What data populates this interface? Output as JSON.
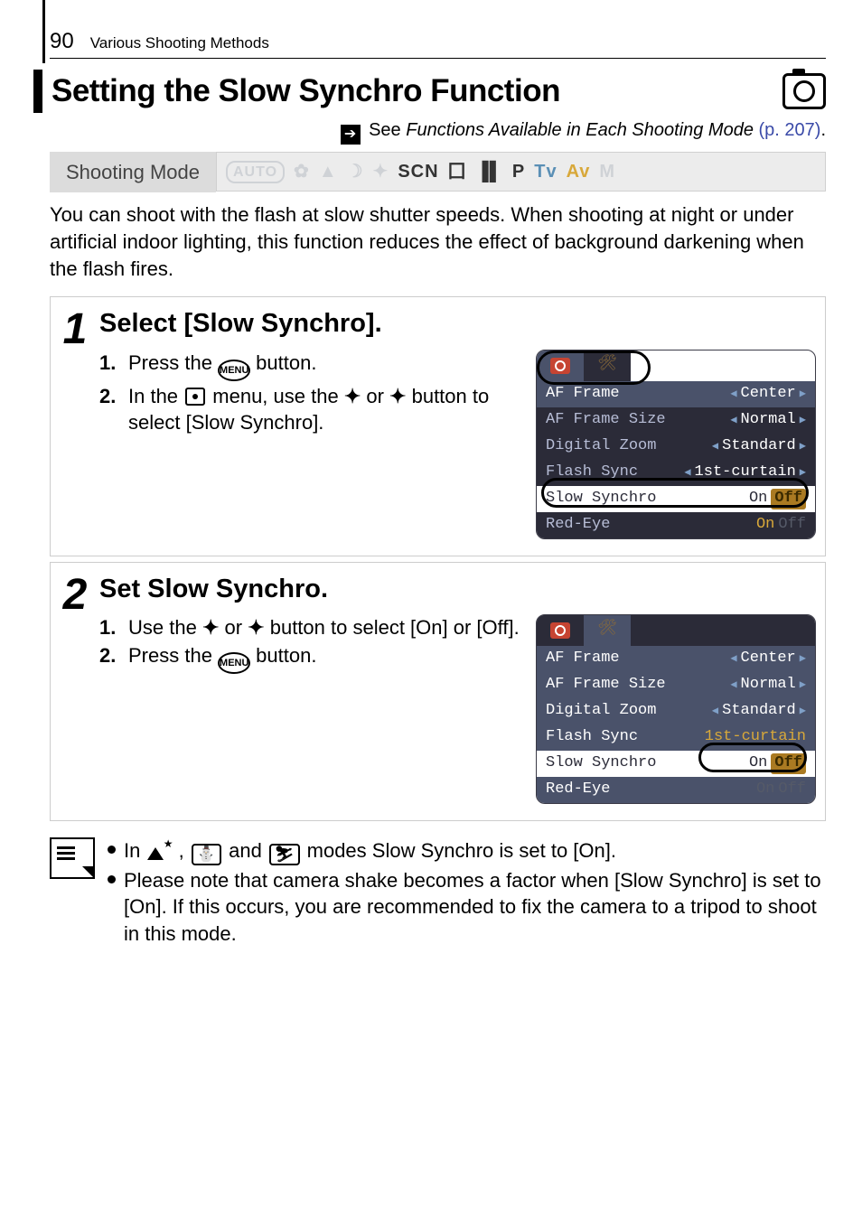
{
  "page": {
    "number": "90",
    "section": "Various Shooting Methods"
  },
  "heading": "Setting the Slow Synchro Function",
  "see": {
    "prefix": "See ",
    "italic": "Functions Available in Each Shooting Mode",
    "link": "(p. 207)",
    "dot": "."
  },
  "mode": {
    "label": "Shooting Mode",
    "band": {
      "auto": "AUTO",
      "scn": "SCN",
      "p": "P",
      "tv": "Tv",
      "av": "Av",
      "m": "M"
    }
  },
  "intro": "You can shoot with the flash at slow shutter speeds. When shooting at night or under artificial indoor lighting, this function reduces the effect of background darkening when the flash fires.",
  "steps": [
    {
      "num": "1",
      "title": "Select [Slow Synchro].",
      "lines": [
        {
          "lbl": "1.",
          "before": "Press the ",
          "btn": "MENU",
          "after": " button."
        },
        {
          "lbl": "2.",
          "text_a": "In the ",
          "text_b": " menu, use the ",
          "text_c": " or ",
          "text_d": " button to select [Slow Synchro]."
        }
      ],
      "shot": {
        "rows": [
          {
            "k": "AF Frame",
            "v": "Center",
            "hl": true
          },
          {
            "k": "AF Frame Size",
            "v": "Normal"
          },
          {
            "k": "Digital Zoom",
            "v": "Standard"
          },
          {
            "k": "Flash Sync",
            "v": "1st-curtain"
          },
          {
            "k": "Slow Synchro",
            "v_on": "On",
            "v_off": "Off",
            "boxed": true
          },
          {
            "k": "Red-Eye",
            "v_on": "On",
            "v_off_dim": "Off"
          }
        ]
      }
    },
    {
      "num": "2",
      "title": "Set Slow Synchro.",
      "lines": [
        {
          "lbl": "1.",
          "text_a": "Use the ",
          "text_b": " or ",
          "text_c": " button to select [On] or [Off]."
        },
        {
          "lbl": "2.",
          "before": "Press the ",
          "btn": "MENU",
          "after": " button."
        }
      ],
      "shot": {
        "rows": [
          {
            "k": "AF Frame",
            "v": "Center"
          },
          {
            "k": "AF Frame Size",
            "v": "Normal"
          },
          {
            "k": "Digital Zoom",
            "v": "Standard"
          },
          {
            "k": "Flash Sync",
            "v": "1st-curtain"
          },
          {
            "k": "Slow Synchro",
            "v_on": "On",
            "v_off": "Off",
            "hl": true,
            "boxed": true
          },
          {
            "k": "Red-Eye",
            "v_on_dim": "On",
            "v_off_dim": "Off"
          }
        ]
      }
    }
  ],
  "notes": [
    {
      "a": "In ",
      "b": " , ",
      "c": " and ",
      "d": " modes Slow Synchro is set to [On]."
    },
    {
      "text": "Please note that camera shake becomes a factor when [Slow Synchro] is set to [On]. If this occurs, you are recommended to fix the camera to a tripod to shoot in this mode."
    }
  ],
  "icons": {
    "personA": "⛄",
    "personB": "⛷"
  }
}
